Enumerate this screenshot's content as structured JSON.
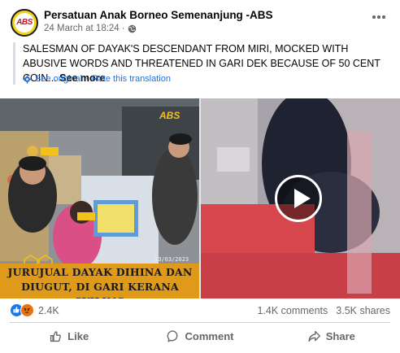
{
  "post": {
    "page_name": "Persatuan Anak Borneo Semenanjung -ABS",
    "date": "24 March at 18:24",
    "separator": "·",
    "avatar_logo": "ABS",
    "text": "SALESMAN OF DAYAK'S DESCENDANT FROM MIRI, MOCKED WITH ABUSIVE WORDS AND THREATENED IN GARI DEK BECAUSE OF 50 CENT COIN...",
    "see_more": "See more",
    "see_original": "See original",
    "rate_translation": "Rate this translation",
    "translation_separator": "·"
  },
  "media": {
    "banner_line1": "JURUJUAL DAYAK DIHINA DAN",
    "banner_line2": "DIUGUT, DI GARI KERANA SYILING",
    "abs_tag": "ABS",
    "video_timestamp": "23/03/2023 17:..."
  },
  "engagement": {
    "reaction_count": "2.4K",
    "comments": "1.4K comments",
    "shares": "3.5K shares",
    "reaction_icons": [
      "like-icon",
      "angry-icon"
    ]
  },
  "actions": {
    "like": "Like",
    "comment": "Comment",
    "share": "Share"
  },
  "colors": {
    "link_blue": "#216fdb",
    "like_blue": "#1877f2",
    "angry_orange": "#e9710f",
    "banner_orange": "#e09a1a",
    "secondary_text": "#65676b"
  }
}
